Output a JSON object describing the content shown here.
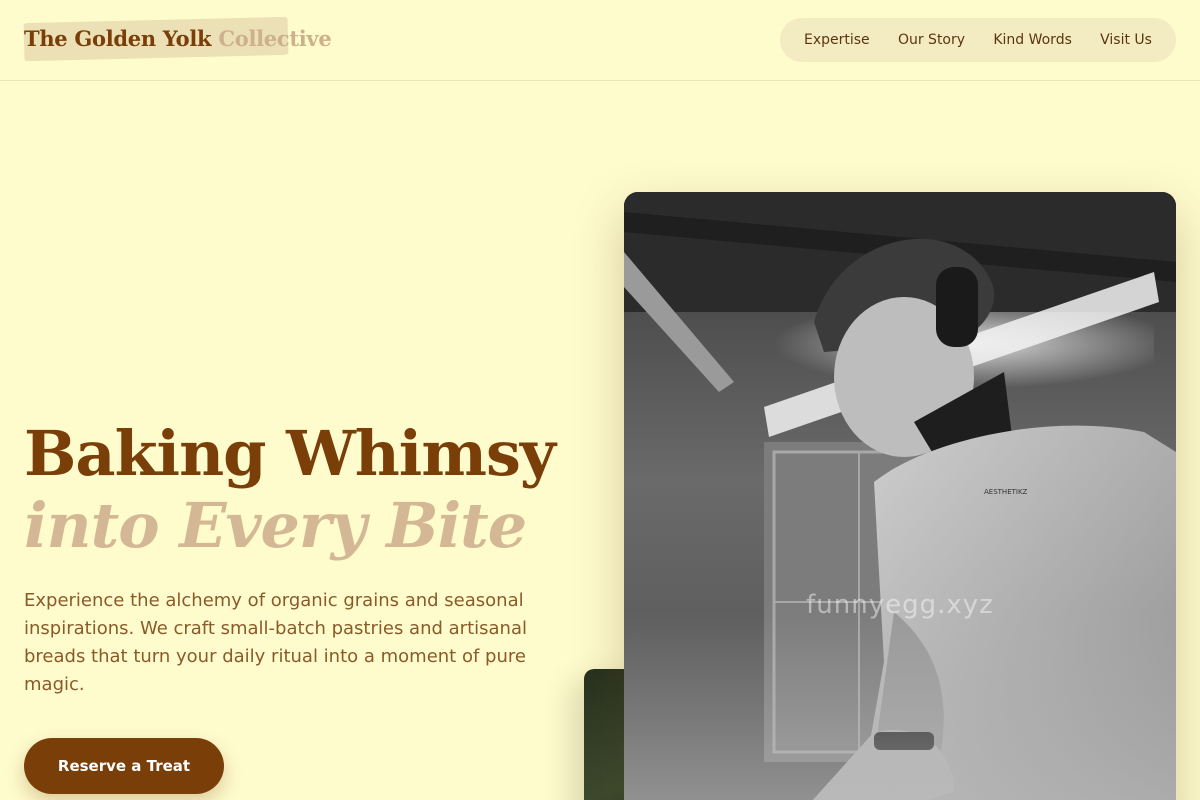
{
  "brand": {
    "name_main": "The Golden Yolk",
    "name_accent": "Collective"
  },
  "nav": {
    "items": [
      "Expertise",
      "Our Story",
      "Kind Words",
      "Visit Us"
    ]
  },
  "hero": {
    "title_line1": "Baking Whimsy",
    "title_line2": "into Every Bite",
    "description": "Experience the alchemy of organic grains and seasonal inspirations. We craft small-batch pastries and artisanal breads that turn your daily ritual into a moment of pure magic.",
    "cta_label": "Reserve a Treat"
  },
  "media": {
    "main_photo_watermark": "funnyegg.xyz"
  },
  "colors": {
    "background": "#fefbcc",
    "brand_brown": "#7a3e09",
    "accent_tan": "#d4b896",
    "nav_pill": "#f3ecc2"
  }
}
